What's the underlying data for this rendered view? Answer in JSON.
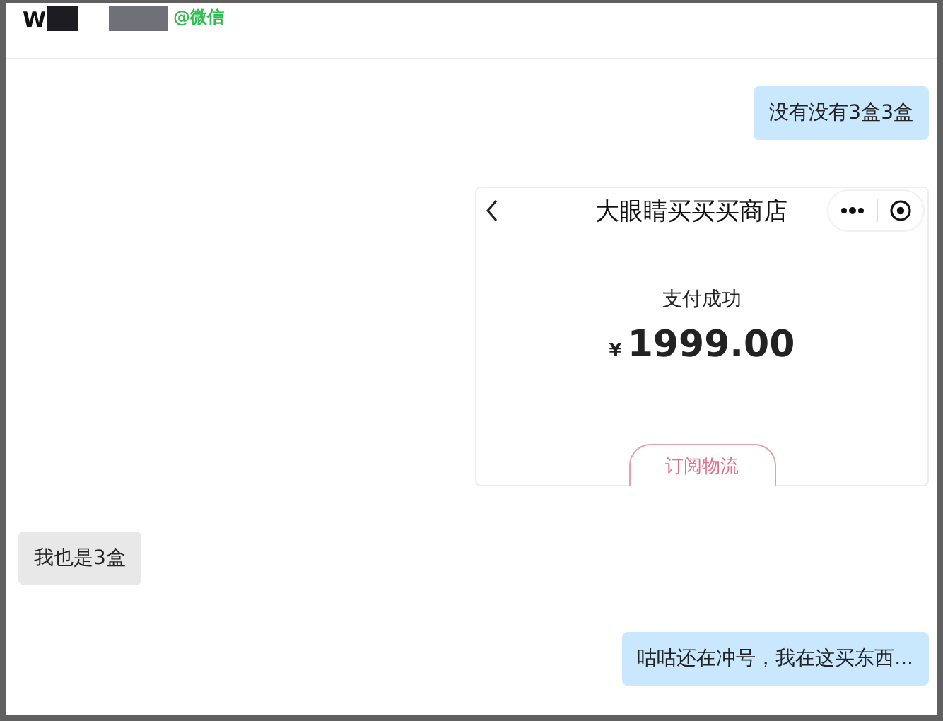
{
  "header": {
    "name_visible": "W",
    "source": "@微信"
  },
  "messages": [
    {
      "kind": "text",
      "outgoing": true,
      "text": "没有没有3盒3盒"
    },
    {
      "kind": "payment_card",
      "outgoing": true,
      "title": "大眼睛买买买商店",
      "status": "支付成功",
      "currency": "¥",
      "amount": "1999.00",
      "button": "订阅物流"
    },
    {
      "kind": "text",
      "outgoing": false,
      "text": "我也是3盒"
    },
    {
      "kind": "text",
      "outgoing": true,
      "text": "咕咕还在冲号，我在这买东西..."
    }
  ]
}
